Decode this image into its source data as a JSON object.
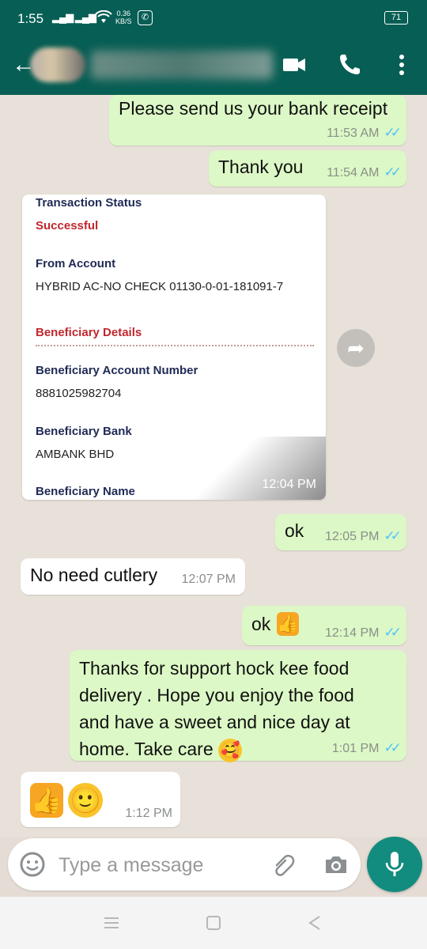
{
  "status_bar": {
    "time": "1:55",
    "network_speed": "0.36",
    "network_speed_unit": "KB/S",
    "battery": "71"
  },
  "header": {
    "contact_name": "",
    "icons": [
      "back-arrow-icon",
      "video-call-icon",
      "phone-icon",
      "more-options-icon"
    ]
  },
  "messages": [
    {
      "direction": "out",
      "text": "Please send us your bank receipt",
      "time": "11:53 AM",
      "ticks": "✓✓"
    },
    {
      "direction": "out",
      "text": "Thank you",
      "time": "11:54 AM",
      "ticks": "✓✓"
    },
    {
      "direction": "in",
      "type": "image",
      "time": "12:04 PM"
    },
    {
      "direction": "out",
      "text": "ok",
      "time": "12:05 PM",
      "ticks": "✓✓"
    },
    {
      "direction": "in",
      "text": "No need cutlery",
      "time": "12:07 PM"
    },
    {
      "direction": "out",
      "text": "ok",
      "emoji": "thumbs-up",
      "time": "12:14 PM",
      "ticks": "✓✓"
    },
    {
      "direction": "out",
      "lines": [
        "Thanks for support hock kee food",
        "delivery . Hope you enjoy the food",
        "and have a sweet and nice day at",
        "home. Take care"
      ],
      "emoji": "smiling-face-with-hearts",
      "time": "1:01 PM",
      "ticks": "✓✓"
    },
    {
      "direction": "in",
      "emoji": [
        "thumbs-up",
        "smiling-face"
      ],
      "time": "1:12 PM"
    }
  ],
  "receipt": {
    "status_label": "Transaction Status",
    "status_value": "Successful",
    "from_label": "From Account",
    "from_value": "HYBRID AC-NO CHECK 01130-0-01-181091-7",
    "beneficiary_header": "Beneficiary Details",
    "account_label": "Beneficiary Account Number",
    "account_value": "8881025982704",
    "bank_label": "Beneficiary Bank",
    "bank_value": "AMBANK BHD",
    "name_label": "Beneficiary Name"
  },
  "input": {
    "placeholder": "Type a message"
  },
  "colors": {
    "header": "#075e54",
    "outgoing_bubble": "#dcf8c6",
    "incoming_bubble": "#ffffff",
    "read_ticks": "#4fc3f7",
    "mic_button": "#128c7e",
    "receipt_accent_red": "#c0272d",
    "receipt_accent_navy": "#1f2a55"
  }
}
